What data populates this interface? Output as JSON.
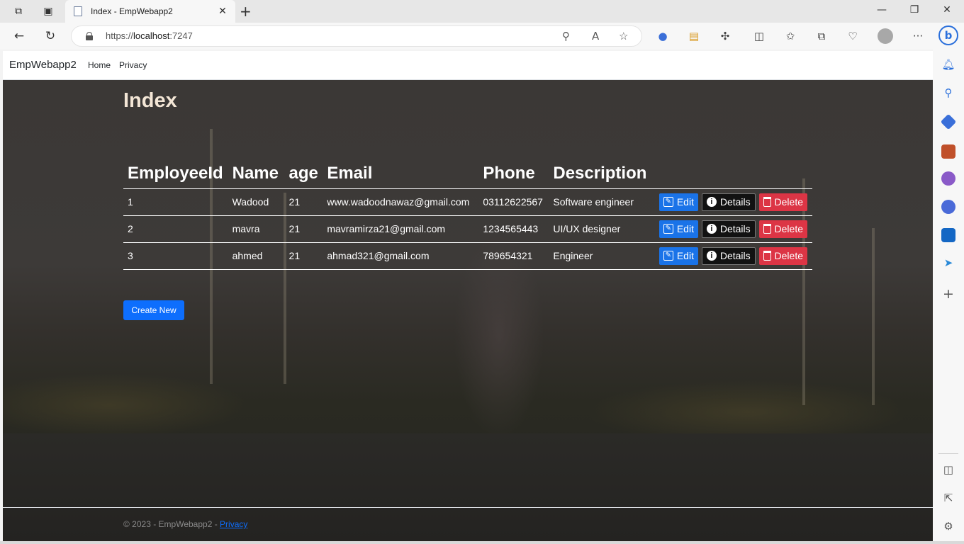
{
  "browser": {
    "tab_title": "Index - EmpWebapp2",
    "tab_close": "✕",
    "new_tab": "+",
    "url_scheme": "https://",
    "url_host": "localhost",
    "url_port": ":7247",
    "window_controls": {
      "minimize": "—",
      "restore": "❐",
      "close": "✕"
    },
    "back": "←",
    "refresh": "↻",
    "more": "···"
  },
  "site": {
    "brand": "EmpWebapp2",
    "nav": [
      "Home",
      "Privacy"
    ]
  },
  "page": {
    "title": "Index",
    "columns": [
      "EmployeeId",
      "Name",
      "age",
      "Email",
      "Phone",
      "Description"
    ],
    "rows": [
      {
        "id": "1",
        "name": "Wadood",
        "age": "21",
        "email": "www.wadoodnawaz@gmail.com",
        "phone": "03112622567",
        "description": "Software engineer"
      },
      {
        "id": "2",
        "name": "mavra",
        "age": "21",
        "email": "mavramirza21@gmail.com",
        "phone": "1234565443",
        "description": "UI/UX designer"
      },
      {
        "id": "3",
        "name": "ahmed",
        "age": "21",
        "email": "ahmad321@gmail.com",
        "phone": "789654321",
        "description": "Engineer"
      }
    ],
    "actions": {
      "edit": "Edit",
      "details": "Details",
      "delete": "Delete"
    },
    "create_new": "Create New"
  },
  "footer": {
    "text": "© 2023 - EmpWebapp2 - ",
    "privacy": "Privacy"
  },
  "colors": {
    "edit": "#1a73e8",
    "details": "#121212",
    "delete": "#dc3545",
    "create": "#0d6efd",
    "title": "#f3e6d6"
  }
}
